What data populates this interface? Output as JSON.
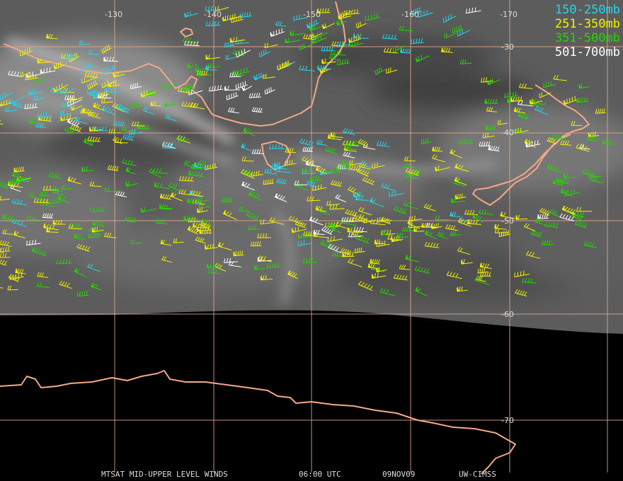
{
  "legend": [
    {
      "label": "150-250mb",
      "color": "#22d8ee"
    },
    {
      "label": "251-350mb",
      "color": "#f2f200"
    },
    {
      "label": "351-500mb",
      "color": "#22d800"
    },
    {
      "label": "501-700mb",
      "color": "#ffffff"
    }
  ],
  "grid": {
    "lon_labels": [
      "-130",
      "-140",
      "-150",
      "-160",
      "-170"
    ],
    "lat_labels": [
      "-30",
      "-40",
      "-50",
      "-60",
      "-70"
    ],
    "line_color": "#e8a888"
  },
  "coastline_color": "#f4a888",
  "footer": {
    "product": "MTSAT MID-UPPER LEVEL WINDS",
    "time": "06:00 UTC",
    "date": "09NOV09",
    "source": "UW-CIMSS"
  },
  "chart_data": {
    "type": "scatter",
    "title": "",
    "series": [
      {
        "name": "150-250mb",
        "color": "#22d8ee"
      },
      {
        "name": "251-350mb",
        "color": "#f2f200"
      },
      {
        "name": "351-500mb",
        "color": "#22d800"
      },
      {
        "name": "501-700mb",
        "color": "#ffffff"
      }
    ]
  }
}
